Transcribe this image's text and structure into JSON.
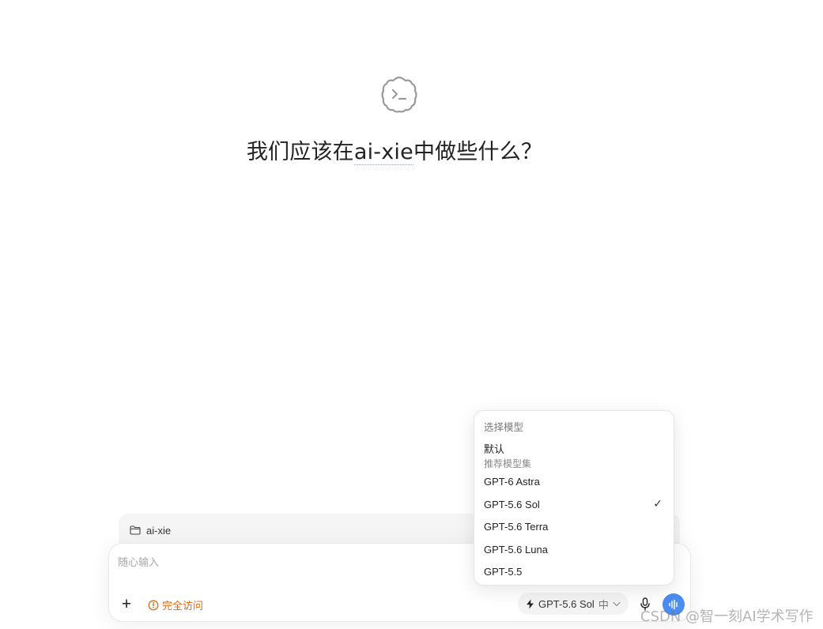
{
  "hero": {
    "logo_icon": "terminal-cloud-icon",
    "heading_prefix": "我们应该在",
    "project_name": "ai-xie",
    "heading_suffix": "中做些什么？"
  },
  "project_bar": {
    "icon": "folder-icon",
    "label": "ai-xie"
  },
  "composer": {
    "placeholder": "随心输入",
    "value": "",
    "add_icon": "plus-icon",
    "add_label": "+",
    "access_icon": "alert-circle-icon",
    "access_label": "完全访问",
    "model_icon": "lightning-icon",
    "model_label": "GPT-5.6 Sol",
    "effort_label": "中",
    "chevron_icon": "chevron-down-icon",
    "mic_icon": "microphone-icon",
    "voice_icon": "voice-wave-icon"
  },
  "model_menu": {
    "title": "选择模型",
    "default_label": "默认",
    "default_sub": "推荐模型集",
    "items": [
      {
        "label": "GPT-6 Astra",
        "selected": false
      },
      {
        "label": "GPT-5.6 Sol",
        "selected": true
      },
      {
        "label": "GPT-5.6 Terra",
        "selected": false
      },
      {
        "label": "GPT-5.6 Luna",
        "selected": false
      },
      {
        "label": "GPT-5.5",
        "selected": false
      }
    ],
    "check_mark": "✓"
  },
  "colors": {
    "accent_orange": "#e06a1b",
    "voice_blue": "#4a8cf0"
  },
  "watermark": "CSDN @智一刻AI学术写作"
}
